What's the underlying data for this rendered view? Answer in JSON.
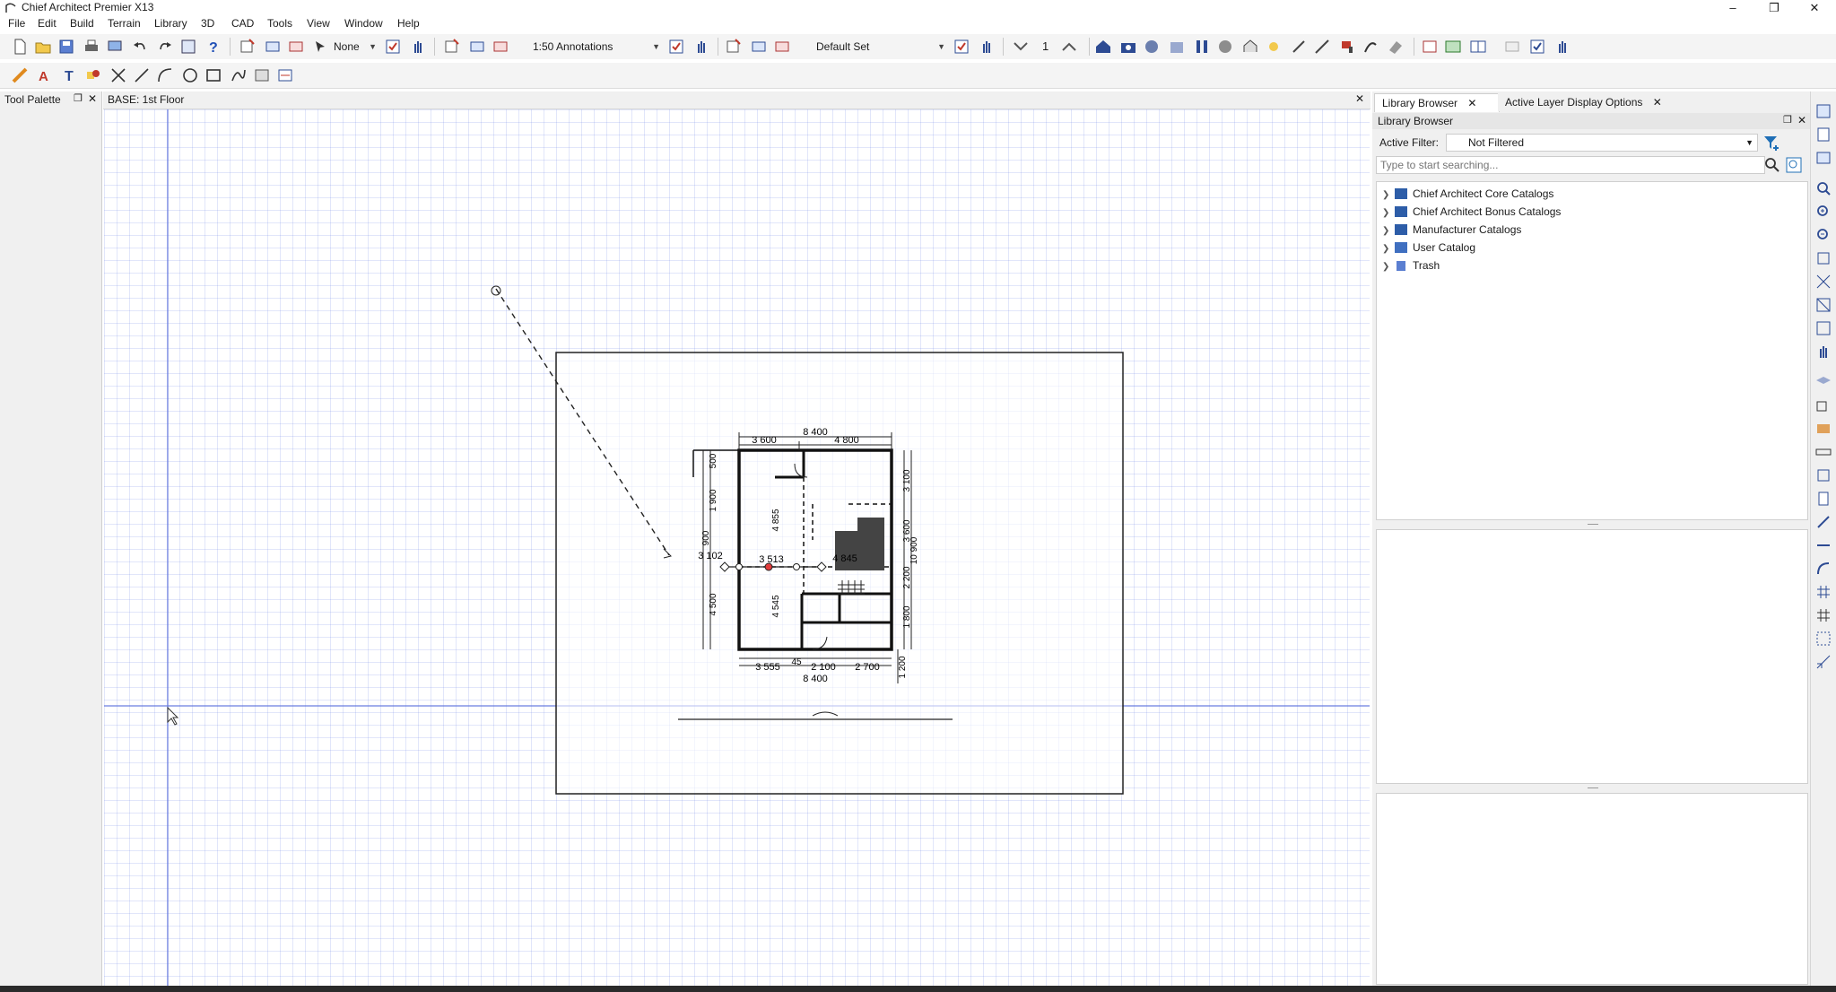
{
  "app": {
    "title": "Chief Architect Premier X13",
    "window_controls": {
      "minimize": "–",
      "maximize": "❐",
      "close": "✕"
    }
  },
  "menu": {
    "items": [
      "File",
      "Edit",
      "Build",
      "Terrain",
      "Library",
      "3D",
      "CAD",
      "Tools",
      "View",
      "Window",
      "Help"
    ]
  },
  "toolbar": {
    "layer_select": "None",
    "annotation_select": "1:50 Annotations",
    "layer_set_select": "Default Set",
    "floor_number": "1"
  },
  "tool_palette": {
    "title": "Tool Palette"
  },
  "view": {
    "tab_title": "BASE: 1st Floor"
  },
  "plan": {
    "dim_top_total": "8 400",
    "dim_top_left": "3 600",
    "dim_top_right": "4 800",
    "dim_right_1": "3 100",
    "dim_right_2": "10 900",
    "dim_right_3": "3 600",
    "dim_right_4": "2 200",
    "dim_right_5": "1 800",
    "dim_right_6": "1 200",
    "dim_left_1": "500",
    "dim_left_2": "1 900",
    "dim_left_3": "900",
    "dim_left_4": "3 102",
    "dim_left_5": "4 500",
    "dim_mid_1": "4 855",
    "dim_mid_2": "3 513",
    "dim_mid_3": "4 845",
    "dim_mid_4": "4 545",
    "dim_bottom_1": "3 555",
    "dim_bottom_2": "45",
    "dim_bottom_3": "2 100",
    "dim_bottom_4": "2 700",
    "dim_bottom_total": "8 400"
  },
  "library": {
    "tabs": [
      "Library Browser",
      "Active Layer Display Options"
    ],
    "title": "Library Browser",
    "filter_label": "Active Filter:",
    "filter_value": "Not Filtered",
    "search_placeholder": "Type to start searching...",
    "tree": [
      "Chief Architect Core Catalogs",
      "Chief Architect Bonus Catalogs",
      "Manufacturer Catalogs",
      "User Catalog",
      "Trash"
    ]
  },
  "colors": {
    "accent": "#3c66c9",
    "grid": "#c8d0f4",
    "wall": "#1a1a1a",
    "highlight": "#e23b3b"
  }
}
